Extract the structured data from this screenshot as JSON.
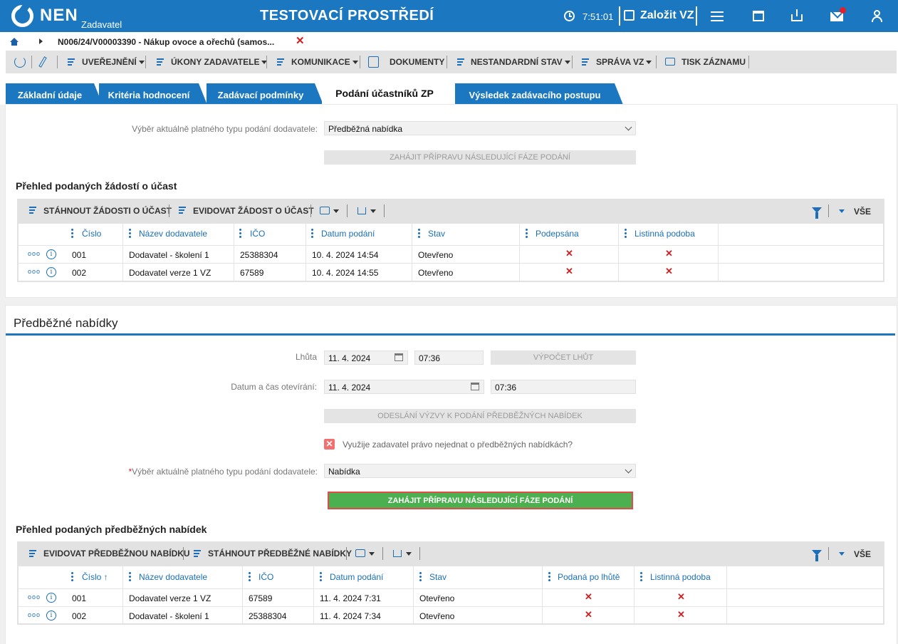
{
  "topbar": {
    "logo": "NEN",
    "logo_sub": "Zadavatel",
    "env_title": "TESTOVACÍ PROSTŘEDÍ",
    "clock": "7:51:01",
    "new_vz": "Založit VZ"
  },
  "breadcrumb": {
    "text": "N006/24/V00003390 - Nákup ovoce a ořechů (samos...",
    "close": "✕"
  },
  "toolbar": {
    "items": [
      "UVEŘEJNĚNÍ",
      "ÚKONY ZADAVATELE",
      "KOMUNIKACE",
      "DOKUMENTY",
      "NESTANDARDNÍ STAV",
      "SPRÁVA VZ",
      "TISK ZÁZNAMU"
    ]
  },
  "tabs": [
    {
      "label": "Základní údaje"
    },
    {
      "label": "Kritéria hodnocení"
    },
    {
      "label": "Zadávací podmínky"
    },
    {
      "label": "Podání účastníků ZP"
    },
    {
      "label": "Výsledek zadávacího postupu"
    }
  ],
  "section1": {
    "type_label": "Výběr aktuálně platného typu podání dodavatele:",
    "type_value": "Předběžná nabídka",
    "start_btn": "ZAHÁJIT PŘÍPRAVU NÁSLEDUJÍCÍ FÁZE PODÁNÍ",
    "grid_title": "Přehled podaných žádostí o účast",
    "grid_actions": [
      "STÁHNOUT ŽÁDOSTI O ÚČAST",
      "EVIDOVAT ŽÁDOST O ÚČAST"
    ],
    "filter_all": "VŠE",
    "columns": [
      "Číslo",
      "Název dodavatele",
      "IČO",
      "Datum podání",
      "Stav",
      "Podepsána",
      "Listinná podoba"
    ],
    "rows": [
      {
        "cislo": "001",
        "nazev": "Dodavatel - školení 1",
        "ico": "25388304",
        "datum": "10. 4. 2024 14:54",
        "stav": "Otevřeno",
        "podepsana": "✕",
        "listinna": "✕"
      },
      {
        "cislo": "002",
        "nazev": "Dodavatel verze 1 VZ",
        "ico": "67589",
        "datum": "10. 4. 2024 14:55",
        "stav": "Otevřeno",
        "podepsana": "✕",
        "listinna": "✕"
      }
    ]
  },
  "section2": {
    "title": "Předběžné nabídky",
    "lhuta_label": "Lhůta",
    "lhuta_date": "11. 4. 2024",
    "lhuta_time": "07:36",
    "vypocet_btn": "VÝPOČET LHŮT",
    "otevirani_label": "Datum a čas otevírání:",
    "otevirani_date": "11. 4. 2024",
    "otevirani_time": "07:36",
    "odeslani_btn": "ODESLÁNÍ VÝZVY K PODÁNÍ PŘEDBĚŽNÝCH NABÍDEK",
    "checkbox_label": "Využije zadavatel právo nejednat o předběžných nabídkách?",
    "required_mark": "*",
    "type_label": "Výběr aktuálně platného typu podání dodavatele:",
    "type_value": "Nabídka",
    "start_btn": "ZAHÁJIT PŘÍPRAVU NÁSLEDUJÍCÍ FÁZE PODÁNÍ",
    "grid_title": "Přehled podaných předběžných nabídek",
    "grid_actions": [
      "EVIDOVAT PŘEDBĚŽNOU NABÍDKU",
      "STÁHNOUT PŘEDBĚŽNÉ NABÍDKY"
    ],
    "filter_all": "VŠE",
    "columns": [
      "Číslo ↑",
      "Název dodavatele",
      "IČO",
      "Datum podání",
      "Stav",
      "Podaná po lhůtě",
      "Listinná podoba"
    ],
    "rows": [
      {
        "cislo": "001",
        "nazev": "Dodavatel verze 1 VZ",
        "ico": "67589",
        "datum": "11. 4. 2024 7:31",
        "stav": "Otevřeno",
        "po_lhute": "✕",
        "listinna": "✕"
      },
      {
        "cislo": "002",
        "nazev": "Dodavatel - školení 1",
        "ico": "25388304",
        "datum": "11. 4. 2024 7:34",
        "stav": "Otevřeno",
        "po_lhute": "✕",
        "listinna": "✕"
      }
    ]
  },
  "row_actions": {
    "more": "ooo",
    "info": "i"
  },
  "colors": {
    "brand": "#1b78c0",
    "danger": "#d21e1e",
    "primary_action": "#4caf50"
  }
}
